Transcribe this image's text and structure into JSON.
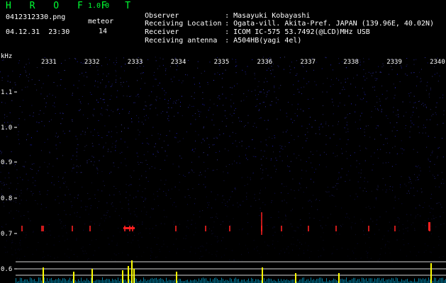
{
  "header": {
    "app_title": "H R O F F T",
    "app_version": "1.0.0",
    "file_name": "0412312330.png",
    "datetime": "04.12.31  23:30",
    "meteor_label": "meteor",
    "meteor_count": "14"
  },
  "meta": [
    {
      "key": "Observer",
      "value": "Masayuki Kobayashi"
    },
    {
      "key": "Receiving Location",
      "value": "Ogata-vill. Akita-Pref. JAPAN (139.96E, 40.02N)"
    },
    {
      "key": "Receiver",
      "value": "ICOM IC-575 53.7492(@LCD)MHz USB"
    },
    {
      "key": "Receiving antenna",
      "value": "A504HB(yagi 4el)"
    }
  ],
  "axis": {
    "unit_label": "kHz",
    "y_ticks": [
      "1.1",
      "1.0",
      "0.9",
      "0.8",
      "0.7",
      "0.6"
    ],
    "x_ticks": [
      "2331",
      "2332",
      "2333",
      "2334",
      "2335",
      "2336",
      "2337",
      "2338",
      "2339",
      "2340"
    ]
  },
  "colors": {
    "background": "#000000",
    "title_green": "#00ff33",
    "noise_blue": "#2828c8",
    "echo_yellow": "#ffff00",
    "echo_red": "#ff2020",
    "guide_line": "#d8d8d8"
  }
}
